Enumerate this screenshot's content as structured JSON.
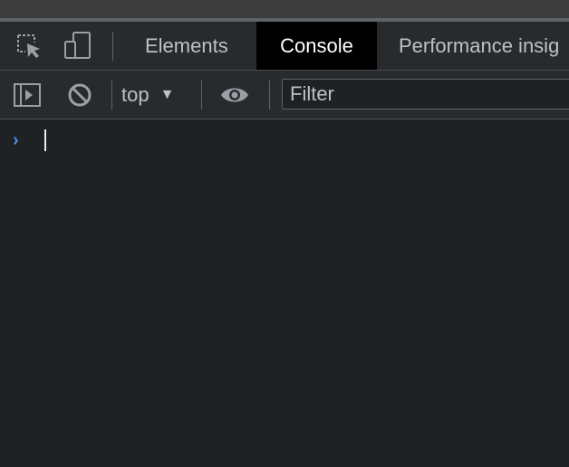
{
  "tabs": [
    {
      "label": "Elements"
    },
    {
      "label": "Console"
    },
    {
      "label": "Performance insig"
    }
  ],
  "active_tab": "Console",
  "icons": {
    "inspect": "inspect-element-icon",
    "device": "device-toolbar-icon",
    "sidebar": "show-sidebar-icon",
    "clear": "clear-console-icon",
    "eye": "live-expression-icon"
  },
  "toolbar": {
    "context_label": "top",
    "filter_placeholder": "Filter"
  },
  "colors": {
    "background": "#202124",
    "panel": "#292a2d",
    "prompt_accent": "#4a90e2",
    "active_tab_bg": "#000000"
  }
}
